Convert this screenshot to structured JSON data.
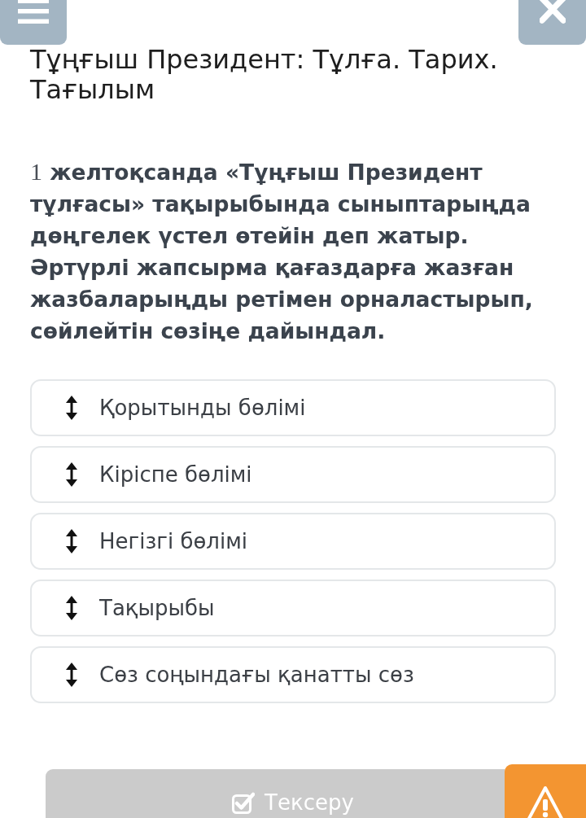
{
  "title": "Тұңғыш Президент: Тұлға. Тарих. Тағылым",
  "question": {
    "number": "1",
    "text": "желтоқсанда «Тұңғыш Президент тұлғасы» тақырыбында сыныптарыңда дөңгелек үстел өтейін деп жатыр. Әртүрлі жапсырма қағаздарға жазған жазбаларыңды ретімен орналастырып, сөйлейтін сөзіңе дайындал."
  },
  "items": [
    {
      "label": "Қорытынды бөлімі"
    },
    {
      "label": "Кіріспе бөлімі"
    },
    {
      "label": "Негізгі бөлімі"
    },
    {
      "label": "Тақырыбы"
    },
    {
      "label": "Сөз соңындағы қанатты сөз"
    }
  ],
  "check_button": {
    "label": "Тексеру",
    "disabled": true
  }
}
